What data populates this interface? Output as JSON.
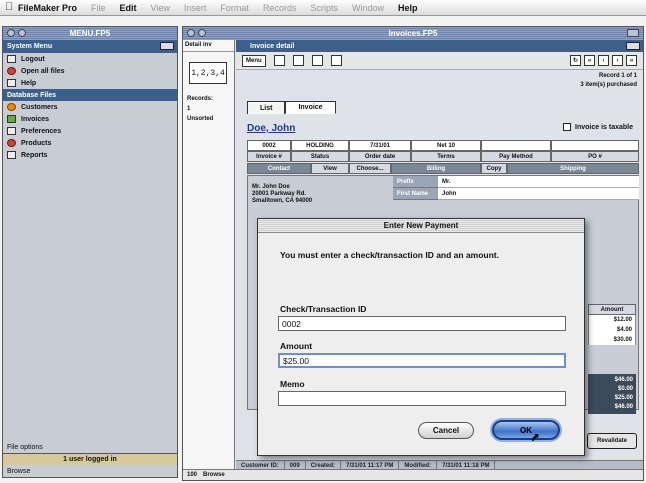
{
  "menubar": {
    "app": "FileMaker Pro",
    "items": [
      "File",
      "Edit",
      "View",
      "Insert",
      "Format",
      "Records",
      "Scripts",
      "Window",
      "Help"
    ],
    "active": [
      "FileMaker Pro",
      "Edit",
      "Help"
    ]
  },
  "menu_window": {
    "title": "MENU.FP5",
    "header": "System Menu",
    "system_items": [
      {
        "label": "Logout",
        "icon": "door-icon"
      },
      {
        "label": "Open all files",
        "icon": "files-icon"
      },
      {
        "label": "Help",
        "icon": "help-icon"
      }
    ],
    "section": "Database Files",
    "db_items": [
      {
        "label": "Customers",
        "icon": "customers-icon"
      },
      {
        "label": "Invoices",
        "icon": "invoices-icon"
      },
      {
        "label": "Preferences",
        "icon": "preferences-icon"
      },
      {
        "label": "Products",
        "icon": "products-icon"
      },
      {
        "label": "Reports",
        "icon": "reports-icon"
      }
    ],
    "file_options": "File options",
    "user_status": "1 user logged in",
    "footer": "Browse"
  },
  "invoice_window": {
    "title": "Invoices.FP5",
    "layout_label": "Detail inv",
    "layout_book": "1,2,3,4",
    "records_label": "Records:",
    "records_count": "1",
    "unsorted": "Unsorted",
    "detail_header": "Invoice detail",
    "menu_button": "Menu",
    "record_info": [
      "Record 1 of 1",
      "3 item(s) purchased"
    ],
    "tabs": [
      "List",
      "Invoice"
    ],
    "active_tab": "Invoice",
    "customer_name": "Doe, John",
    "taxable_label": "Invoice is taxable",
    "values_row": [
      "0002",
      "HOLDING",
      "7/31/01",
      "Net 10",
      "",
      ""
    ],
    "labels_row": [
      "Invoice #",
      "Status",
      "Order date",
      "Terms",
      "Pay Method",
      "PO #"
    ],
    "contact_row": [
      "Contact",
      "View",
      "Choose...",
      "Billing",
      "Copy",
      "Shipping"
    ],
    "address": [
      "Mr. John Doe",
      "20001 Parkway Rd.",
      "Smalltown, CA 94000"
    ],
    "billing": [
      {
        "label": "Prefix",
        "value": "Mr."
      },
      {
        "label": "First Name",
        "value": "John"
      }
    ],
    "amount_header": "Amount",
    "amounts": [
      "$12.00",
      "$4.00",
      "$30.00"
    ],
    "totals": [
      "$46.00",
      "$0.00",
      "$25.00",
      "$46.00"
    ],
    "revalidate": "Revalidate",
    "status_bar": [
      "Customer ID:",
      "009",
      "Created:",
      "7/31/01 11:17 PM",
      "Modified:",
      "7/31/01 11:18 PM"
    ],
    "footer": [
      "100",
      "Browse"
    ]
  },
  "dialog": {
    "title": "Enter New Payment",
    "message": "You must enter a check/transaction ID and an amount.",
    "fields": [
      {
        "label": "Check/Transaction ID",
        "value": "0002"
      },
      {
        "label": "Amount",
        "value": "$25.00"
      },
      {
        "label": "Memo",
        "value": ""
      }
    ],
    "cancel_label": "Cancel",
    "ok_label": "OK"
  }
}
